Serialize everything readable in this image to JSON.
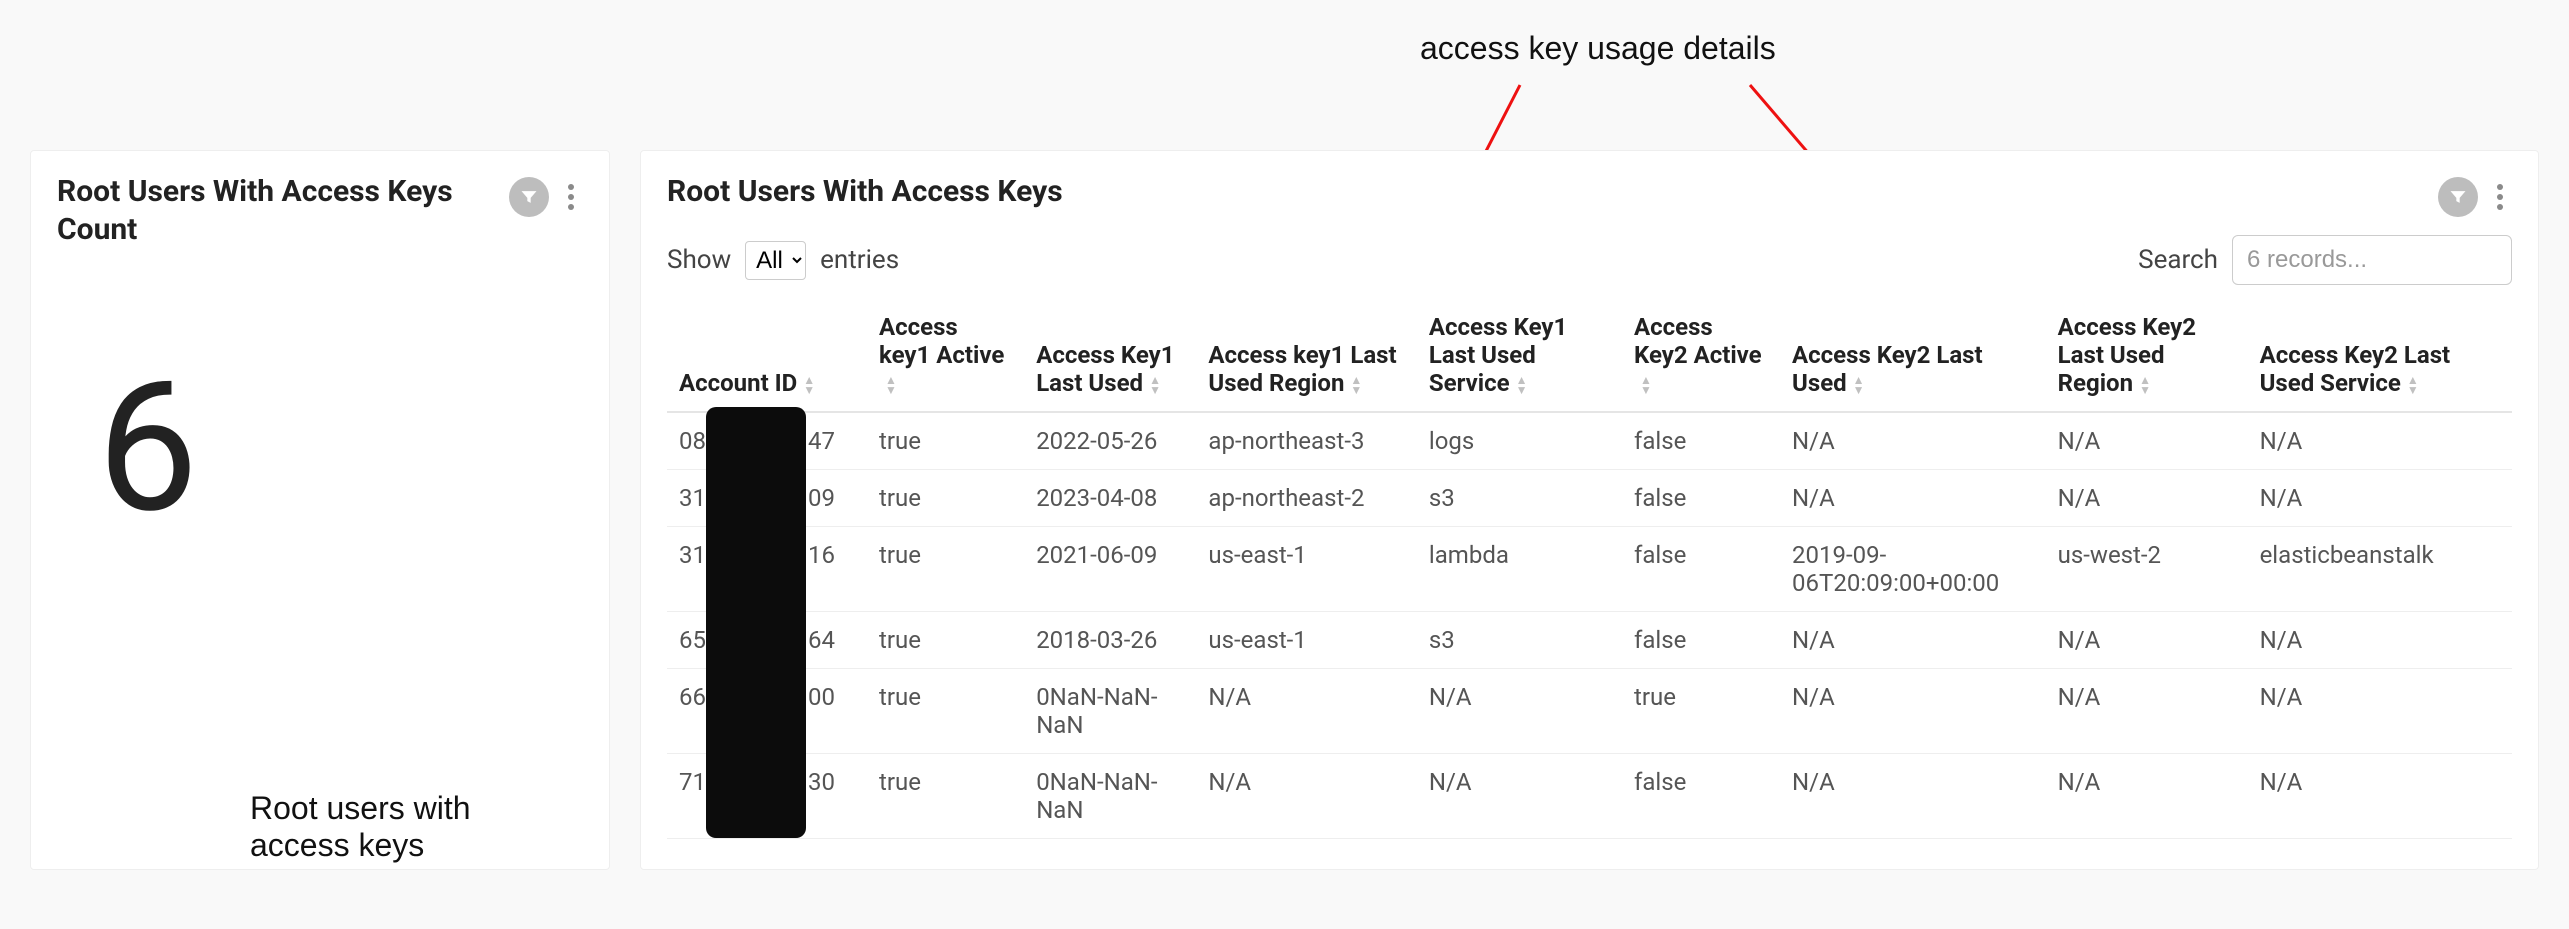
{
  "annotations": {
    "top_label": "access key usage details",
    "bottom_label": "Root users with\naccess keys"
  },
  "count_panel": {
    "title": "Root Users With Access Keys Count",
    "value": "6"
  },
  "table_panel": {
    "title": "Root Users With Access Keys",
    "show_label": "Show",
    "entries_label": "entries",
    "show_option": "All",
    "search_label": "Search",
    "search_placeholder": "6 records...",
    "columns": {
      "account_id": "Account ID",
      "k1_active": "Access key1 Active",
      "k1_last_used": "Access Key1 Last Used",
      "k1_region": "Access key1 Last Used Region",
      "k1_service": "Access Key1 Last Used Service",
      "k2_active": "Access Key2 Active",
      "k2_last_used": "Access Key2 Last Used",
      "k2_region": "Access Key2 Last Used Region",
      "k2_service": "Access Key2 Last Used Service"
    },
    "rows": [
      {
        "account_prefix": "08",
        "account_suffix": "47",
        "k1_active": "true",
        "k1_last_used": "2022-05-26",
        "k1_region": "ap-northeast-3",
        "k1_service": "logs",
        "k2_active": "false",
        "k2_last_used": "N/A",
        "k2_region": "N/A",
        "k2_service": "N/A"
      },
      {
        "account_prefix": "31",
        "account_suffix": "09",
        "k1_active": "true",
        "k1_last_used": "2023-04-08",
        "k1_region": "ap-northeast-2",
        "k1_service": "s3",
        "k2_active": "false",
        "k2_last_used": "N/A",
        "k2_region": "N/A",
        "k2_service": "N/A"
      },
      {
        "account_prefix": "31",
        "account_suffix": "16",
        "k1_active": "true",
        "k1_last_used": "2021-06-09",
        "k1_region": "us-east-1",
        "k1_service": "lambda",
        "k2_active": "false",
        "k2_last_used": "2019-09-06T20:09:00+00:00",
        "k2_region": "us-west-2",
        "k2_service": "elasticbeanstalk"
      },
      {
        "account_prefix": "65",
        "account_suffix": "64",
        "k1_active": "true",
        "k1_last_used": "2018-03-26",
        "k1_region": "us-east-1",
        "k1_service": "s3",
        "k2_active": "false",
        "k2_last_used": "N/A",
        "k2_region": "N/A",
        "k2_service": "N/A"
      },
      {
        "account_prefix": "66",
        "account_suffix": "00",
        "k1_active": "true",
        "k1_last_used": "0NaN-NaN-NaN",
        "k1_region": "N/A",
        "k1_service": "N/A",
        "k2_active": "true",
        "k2_last_used": "N/A",
        "k2_region": "N/A",
        "k2_service": "N/A"
      },
      {
        "account_prefix": "71",
        "account_suffix": "30",
        "k1_active": "true",
        "k1_last_used": "0NaN-NaN-NaN",
        "k1_region": "N/A",
        "k1_service": "N/A",
        "k2_active": "false",
        "k2_last_used": "N/A",
        "k2_region": "N/A",
        "k2_service": "N/A"
      }
    ]
  }
}
